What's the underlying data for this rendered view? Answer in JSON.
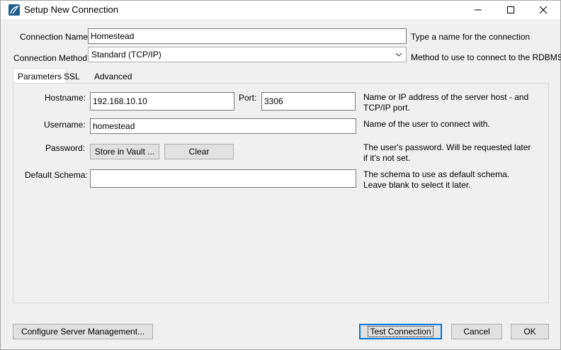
{
  "window": {
    "title": "Setup New Connection"
  },
  "form": {
    "connection_name_label": "Connection Name:",
    "connection_name_value": "Homestead",
    "connection_name_hint": "Type a name for the connection",
    "connection_method_label": "Connection Method:",
    "connection_method_value": "Standard (TCP/IP)",
    "connection_method_hint": "Method to use to connect to the RDBMS"
  },
  "tabs": [
    {
      "label": "Parameters",
      "active": true
    },
    {
      "label": "SSL",
      "active": false
    },
    {
      "label": "Advanced",
      "active": false
    }
  ],
  "parameters": {
    "hostname_label": "Hostname:",
    "hostname_value": "192.168.10.10",
    "port_label": "Port:",
    "port_value": "3306",
    "hostname_hint": "Name or IP address of the server host - and TCP/IP port.",
    "username_label": "Username:",
    "username_value": "homestead",
    "username_hint": "Name of the user to connect with.",
    "password_label": "Password:",
    "store_vault_label": "Store in Vault ...",
    "clear_label": "Clear",
    "password_hint": "The user's password. Will be requested later if it's not set.",
    "schema_label": "Default Schema:",
    "schema_value": "",
    "schema_hint": "The schema to use as default schema. Leave blank to select it later."
  },
  "footer": {
    "configure_label": "Configure Server Management...",
    "test_label": "Test Connection",
    "cancel_label": "Cancel",
    "ok_label": "OK"
  },
  "icons": {
    "app": "mysql-workbench-icon",
    "minimize": "minimize-icon",
    "maximize": "maximize-icon",
    "close": "close-icon",
    "dropdown": "chevron-down-icon"
  },
  "colors": {
    "accent": "#0078d7",
    "panel": "#f0f0f0",
    "button": "#e1e1e1"
  }
}
